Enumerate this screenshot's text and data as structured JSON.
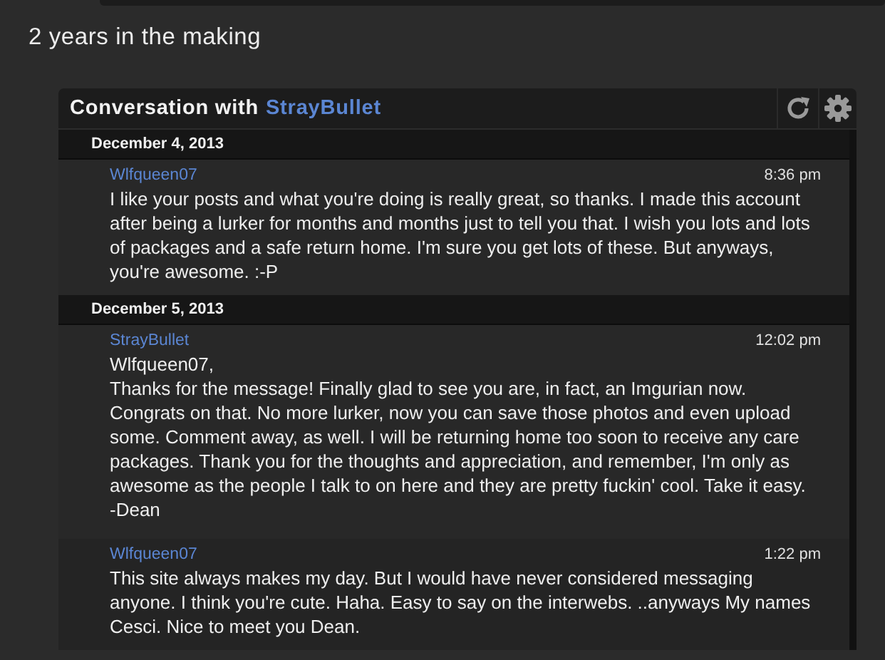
{
  "page_title": "2 years in the making",
  "conversation": {
    "title": "Conversation with",
    "partner": "StrayBullet",
    "days": [
      {
        "date": "December 4, 2013",
        "messages": [
          {
            "author": "Wlfqueen07",
            "time": "8:36 pm",
            "lines": [
              "I like your posts and what you're doing is really great, so thanks. I made this account after being a lurker for months and months just to tell you that. I wish you lots and lots of packages and a safe return home. I'm sure you get lots of these. But anyways, you're awesome. :-P"
            ]
          }
        ]
      },
      {
        "date": "December 5, 2013",
        "messages": [
          {
            "author": "StrayBullet",
            "time": "12:02 pm",
            "lines": [
              "Wlfqueen07,",
              "Thanks for the message! Finally glad to see you are, in fact, an Imgurian now. Congrats on that. No more lurker, now you can save those photos and even upload some. Comment away, as well. I will be returning home too soon to receive any care packages. Thank you for the thoughts and appreciation, and remember, I'm only as awesome as the people I talk to on here and they are pretty fuckin' cool. Take it easy.",
              "-Dean"
            ]
          },
          {
            "author": "Wlfqueen07",
            "time": "1:22 pm",
            "lines": [
              "This site always makes my day. But I would have never considered messaging anyone. I think you're cute. Haha. Easy to say on the interwebs. ..anyways My names Cesci. Nice to meet you Dean."
            ]
          }
        ]
      }
    ]
  }
}
